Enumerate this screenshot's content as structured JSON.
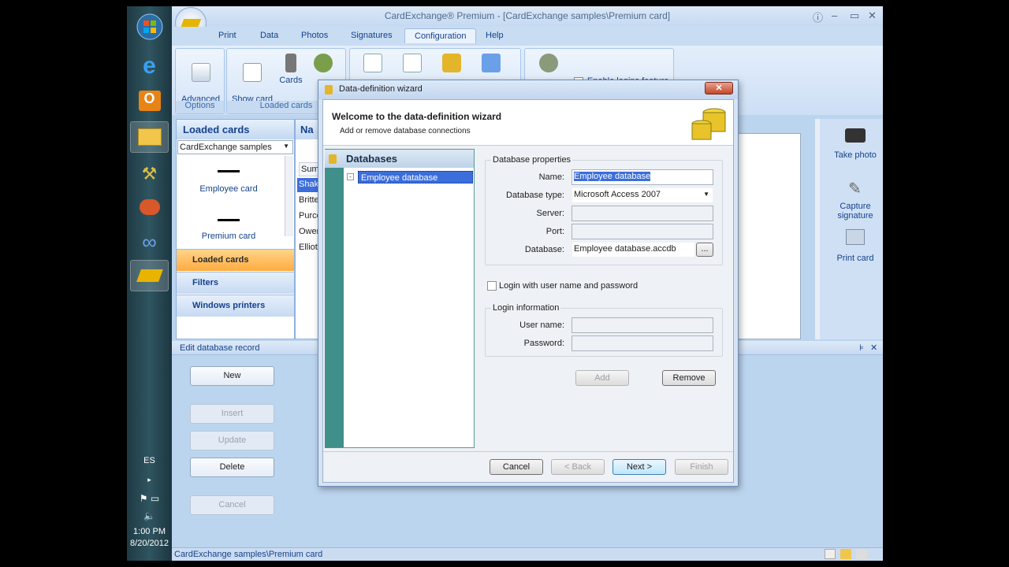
{
  "taskbar": {
    "lang": "ES",
    "time": "1:00 PM",
    "date": "8/20/2012"
  },
  "app": {
    "title": "CardExchange® Premium - [CardExchange samples\\Premium card]",
    "tabs": [
      "Print",
      "Data",
      "Photos",
      "Signatures",
      "Configuration",
      "Help"
    ],
    "active_tab": "Configuration",
    "ribbon": {
      "advanced_options": "Advanced\noptions",
      "options_group": "Options",
      "show_card_manager": "Show card\nmanager",
      "cards": "Cards",
      "loaded_cards_group": "Loaded cards",
      "enable_logins": "Enable logins feature"
    },
    "left_panel": {
      "title": "Loaded cards",
      "dropdown": "CardExchange samples",
      "cards": [
        "Employee card",
        "Premium card"
      ],
      "nav": [
        "Loaded cards",
        "Filters",
        "Windows printers"
      ]
    },
    "mid_list": {
      "header": "Na",
      "items": [
        "Sum",
        "Shak",
        "Britte",
        "Purce",
        "Owen",
        "Elliot"
      ]
    },
    "right_panel": {
      "take_photo": "Take photo",
      "capture_signature": "Capture\nsignature",
      "print_card": "Print card"
    },
    "edit_panel": {
      "title": "Edit database record",
      "buttons": [
        "New",
        "Insert",
        "Update",
        "Delete",
        "Cancel"
      ]
    },
    "status": "CardExchange samples\\Premium card"
  },
  "dialog": {
    "title": "Data-definition wizard",
    "heading": "Welcome to the data-definition wizard",
    "subheading": "Add or remove database connections",
    "databases_header": "Databases",
    "databases": [
      "Employee database"
    ],
    "db_properties_legend": "Database properties",
    "labels": {
      "name": "Name:",
      "db_type": "Database type:",
      "server": "Server:",
      "port": "Port:",
      "database": "Database:",
      "user": "User name:",
      "password": "Password:"
    },
    "values": {
      "name": "Employee database",
      "db_type": "Microsoft Access 2007",
      "database": "Employee database.accdb"
    },
    "browse": "...",
    "login_check": "Login with user name and password",
    "login_legend": "Login information",
    "add": "Add",
    "remove": "Remove",
    "cancel": "Cancel",
    "back": "< Back",
    "next": "Next >",
    "finish": "Finish"
  }
}
